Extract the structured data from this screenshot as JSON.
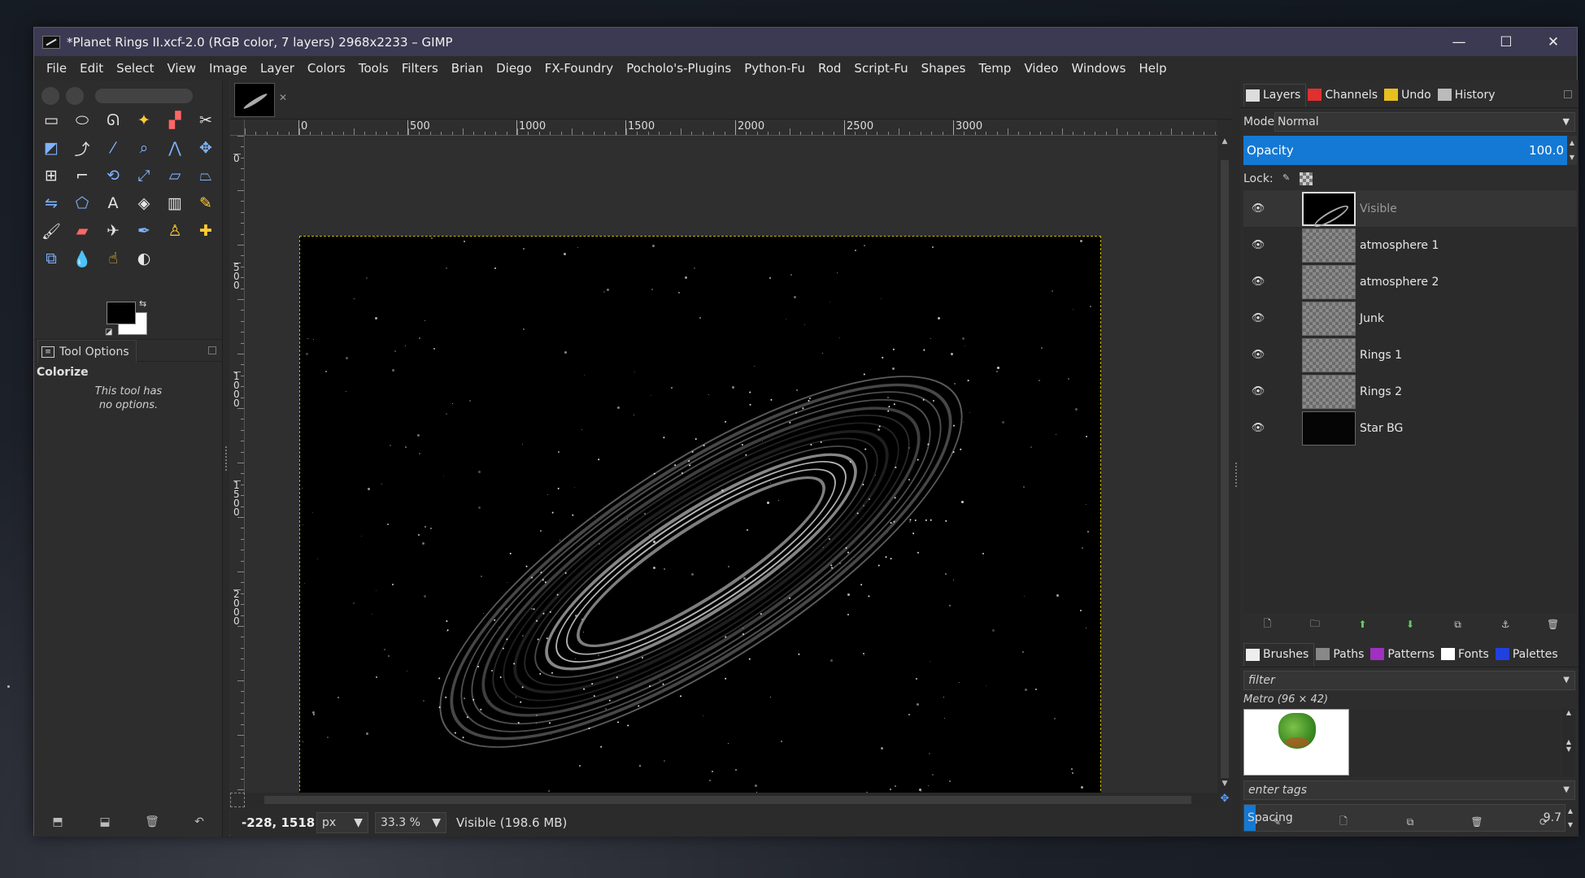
{
  "window": {
    "title": "*Planet Rings II.xcf-2.0 (RGB color, 7 layers) 2968x2233 – GIMP",
    "controls": {
      "minimize": "—",
      "maximize": "☐",
      "close": "✕"
    }
  },
  "menubar": [
    "File",
    "Edit",
    "Select",
    "View",
    "Image",
    "Layer",
    "Colors",
    "Tools",
    "Filters",
    "Brian",
    "Diego",
    "FX-Foundry",
    "Pocholo's-Plugins",
    "Python-Fu",
    "Rod",
    "Script-Fu",
    "Shapes",
    "Temp",
    "Video",
    "Windows",
    "Help"
  ],
  "toolbox": {
    "tools": [
      {
        "name": "rect-select-icon",
        "glyph": "▭",
        "color": "c1"
      },
      {
        "name": "ellipse-select-icon",
        "glyph": "⬭",
        "color": "c1"
      },
      {
        "name": "free-select-icon",
        "glyph": "ᘏ",
        "color": "c1"
      },
      {
        "name": "fuzzy-select-icon",
        "glyph": "✦",
        "color": "c3"
      },
      {
        "name": "select-by-color-icon",
        "glyph": "▞",
        "color": "c4"
      },
      {
        "name": "scissors-select-icon",
        "glyph": "✂",
        "color": "c1"
      },
      {
        "name": "foreground-select-icon",
        "glyph": "◩",
        "color": "c2"
      },
      {
        "name": "paths-icon",
        "glyph": "⤴",
        "color": "c1"
      },
      {
        "name": "color-picker-icon",
        "glyph": "⁄",
        "color": "c2"
      },
      {
        "name": "zoom-icon",
        "glyph": "⌕",
        "color": "c2"
      },
      {
        "name": "measure-icon",
        "glyph": "⋀",
        "color": "c2"
      },
      {
        "name": "move-icon",
        "glyph": "✥",
        "color": "c2"
      },
      {
        "name": "align-icon",
        "glyph": "⊞",
        "color": "c1"
      },
      {
        "name": "crop-icon",
        "glyph": "⌐",
        "color": "c1"
      },
      {
        "name": "rotate-icon",
        "glyph": "⟲",
        "color": "c2"
      },
      {
        "name": "scale-icon",
        "glyph": "⤢",
        "color": "c2"
      },
      {
        "name": "shear-icon",
        "glyph": "▱",
        "color": "c2"
      },
      {
        "name": "perspective-icon",
        "glyph": "⏢",
        "color": "c2"
      },
      {
        "name": "flip-icon",
        "glyph": "⇋",
        "color": "c2"
      },
      {
        "name": "cage-transform-icon",
        "glyph": "⬠",
        "color": "c2"
      },
      {
        "name": "text-icon",
        "glyph": "A",
        "color": "c1"
      },
      {
        "name": "bucket-fill-icon",
        "glyph": "◈",
        "color": "c1"
      },
      {
        "name": "blend-icon",
        "glyph": "▥",
        "color": "c1"
      },
      {
        "name": "pencil-icon",
        "glyph": "✎",
        "color": "c3"
      },
      {
        "name": "paintbrush-icon",
        "glyph": "🖌",
        "color": "c1"
      },
      {
        "name": "eraser-icon",
        "glyph": "▰",
        "color": "c4"
      },
      {
        "name": "airbrush-icon",
        "glyph": "✈",
        "color": "c1"
      },
      {
        "name": "ink-icon",
        "glyph": "✒",
        "color": "c2"
      },
      {
        "name": "clone-icon",
        "glyph": "♙",
        "color": "c3"
      },
      {
        "name": "heal-icon",
        "glyph": "✚",
        "color": "c3"
      },
      {
        "name": "perspective-clone-icon",
        "glyph": "⧉",
        "color": "c2"
      },
      {
        "name": "blur-icon",
        "glyph": "💧",
        "color": "c2"
      },
      {
        "name": "smudge-icon",
        "glyph": "☝",
        "color": "c3"
      },
      {
        "name": "dodge-burn-icon",
        "glyph": "◐",
        "color": "c1"
      }
    ],
    "tool_options_tab": "Tool Options",
    "tool_options_title": "Colorize",
    "tool_options_message_line1": "This tool has",
    "tool_options_message_line2": "no options.",
    "bottom_buttons": [
      {
        "name": "save-tool-preset-icon",
        "glyph": "⬒"
      },
      {
        "name": "restore-tool-preset-icon",
        "glyph": "⬓"
      },
      {
        "name": "delete-tool-preset-icon",
        "glyph": "🗑"
      },
      {
        "name": "reset-tool-options-icon",
        "glyph": "↶"
      }
    ]
  },
  "ruler": {
    "h_labels": [
      "0",
      "500",
      "1000",
      "1500",
      "2000",
      "2500",
      "3000"
    ],
    "v_labels": [
      "0",
      "500",
      "1000",
      "1500",
      "2000"
    ]
  },
  "statusbar": {
    "coords": "-228, 1518",
    "unit": "px",
    "zoom": "33.3 %",
    "status": "Visible (198.6 MB)"
  },
  "dock": {
    "tabs": [
      {
        "label": "Layers",
        "icon": "layers-icon",
        "color": "#dddddd"
      },
      {
        "label": "Channels",
        "icon": "channels-icon",
        "color": "#e03030"
      },
      {
        "label": "Undo",
        "icon": "undo-icon",
        "color": "#e8c020"
      },
      {
        "label": "History",
        "icon": "history-icon",
        "color": "#bbbbbb"
      }
    ],
    "mode_label": "Mode:",
    "mode_value": "Normal",
    "opacity_label": "Opacity",
    "opacity_value": "100.0",
    "lock_label": "Lock:",
    "layers": [
      {
        "name": "Visible",
        "thumb": "visible",
        "selected": true
      },
      {
        "name": "atmosphere 1",
        "thumb": "checker",
        "selected": false
      },
      {
        "name": "atmosphere 2",
        "thumb": "checker",
        "selected": false
      },
      {
        "name": "Junk",
        "thumb": "checker",
        "selected": false
      },
      {
        "name": "Rings 1",
        "thumb": "checker",
        "selected": false
      },
      {
        "name": "Rings 2",
        "thumb": "checker",
        "selected": false
      },
      {
        "name": "Star BG",
        "thumb": "dark",
        "selected": false
      }
    ],
    "layer_buttons": [
      {
        "name": "new-layer-icon",
        "glyph": "🗋",
        "green": false
      },
      {
        "name": "new-layer-group-icon",
        "glyph": "🗀",
        "green": false
      },
      {
        "name": "raise-layer-icon",
        "glyph": "⬆",
        "green": true
      },
      {
        "name": "lower-layer-icon",
        "glyph": "⬇",
        "green": true
      },
      {
        "name": "duplicate-layer-icon",
        "glyph": "⧉",
        "green": false
      },
      {
        "name": "anchor-layer-icon",
        "glyph": "⚓",
        "green": false
      },
      {
        "name": "delete-layer-icon",
        "glyph": "🗑",
        "green": false
      }
    ]
  },
  "dock2": {
    "tabs": [
      {
        "label": "Brushes",
        "icon": "brushes-icon",
        "color": "#eeeeee"
      },
      {
        "label": "Paths",
        "icon": "paths-icon",
        "color": "#888888"
      },
      {
        "label": "Patterns",
        "icon": "patterns-icon",
        "color": "#a030c0"
      },
      {
        "label": "Fonts",
        "icon": "fonts-icon",
        "color": "#ffffff"
      },
      {
        "label": "Palettes",
        "icon": "palettes-icon",
        "color": "#2040e0"
      }
    ],
    "filter_placeholder": "filter",
    "brush_name": "Metro (96 × 42)",
    "tags_placeholder": "enter tags",
    "spacing_label": "Spacing",
    "spacing_value": "9.7",
    "buttons": [
      {
        "name": "edit-brush-icon",
        "glyph": "✎"
      },
      {
        "name": "new-brush-icon",
        "glyph": "🗋"
      },
      {
        "name": "duplicate-brush-icon",
        "glyph": "⧉"
      },
      {
        "name": "delete-brush-icon",
        "glyph": "🗑"
      },
      {
        "name": "refresh-brushes-icon",
        "glyph": "⟳"
      }
    ]
  }
}
